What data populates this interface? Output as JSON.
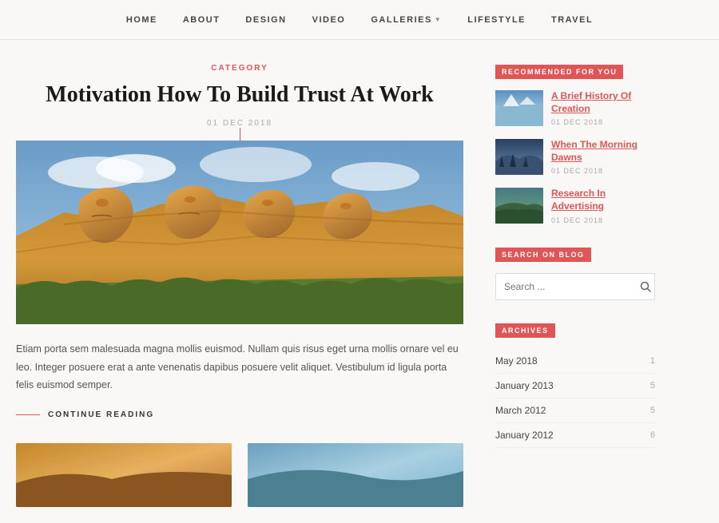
{
  "nav": {
    "items": [
      {
        "label": "Home",
        "link": "home"
      },
      {
        "label": "About",
        "link": "about"
      },
      {
        "label": "Design",
        "link": "design"
      },
      {
        "label": "Video",
        "link": "video"
      },
      {
        "label": "Galleries",
        "link": "galleries",
        "dropdown": true
      },
      {
        "label": "Lifestyle",
        "link": "lifestyle"
      },
      {
        "label": "Travel",
        "link": "travel"
      }
    ]
  },
  "article": {
    "category": "Category",
    "title": "Motivation How To Build Trust At Work",
    "date": "01 Dec 2018",
    "excerpt": "Etiam porta sem malesuada magna mollis euismod. Nullam quis risus eget urna mollis ornare vel eu leo. Integer posuere erat a ante venenatis dapibus posuere velit aliquet. Vestibulum id ligula porta felis euismod semper.",
    "continue_reading": "Continue Reading"
  },
  "sidebar": {
    "recommended_label": "Recommended For You",
    "recommended_items": [
      {
        "title": "A Brief History Of Creation",
        "date": "01 Dec 2018",
        "thumb": "mountains-snow"
      },
      {
        "title": "When The Morning Dawns",
        "date": "01 Dec 2018",
        "thumb": "forest-dark"
      },
      {
        "title": "Research In Advertising",
        "date": "01 Dec 2018",
        "thumb": "green-hills"
      }
    ],
    "search_label": "Search On Blog",
    "search_placeholder": "Search ...",
    "archives_label": "Archives",
    "archives": [
      {
        "month": "May 2018",
        "count": 1
      },
      {
        "month": "January 2013",
        "count": 5
      },
      {
        "month": "March 2012",
        "count": 5
      },
      {
        "month": "January 2012",
        "count": 6
      }
    ]
  }
}
